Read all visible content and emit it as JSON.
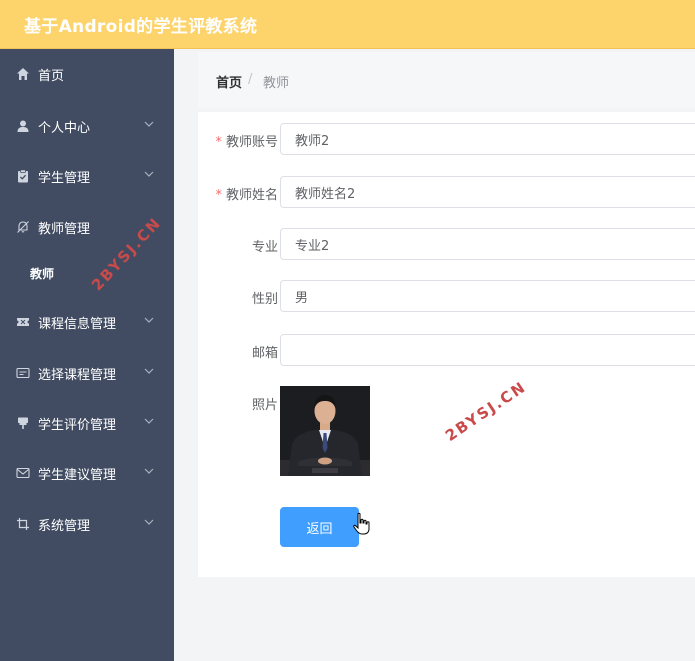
{
  "app": {
    "title": "基于Android的学生评教系统"
  },
  "sidebar": {
    "items": [
      {
        "label": "首页",
        "icon": "home-icon"
      },
      {
        "label": "个人中心",
        "icon": "user-icon"
      },
      {
        "label": "学生管理",
        "icon": "clipboard-icon"
      },
      {
        "label": "教师管理",
        "icon": "bell-off-icon"
      },
      {
        "label": "课程信息管理",
        "icon": "ticket-icon"
      },
      {
        "label": "选择课程管理",
        "icon": "message-box-icon"
      },
      {
        "label": "学生评价管理",
        "icon": "pin-icon"
      },
      {
        "label": "学生建议管理",
        "icon": "mail-icon"
      },
      {
        "label": "系统管理",
        "icon": "crop-icon"
      }
    ],
    "active_sub": "教师"
  },
  "breadcrumb": {
    "home": "首页",
    "separator": "/",
    "current": "教师"
  },
  "form": {
    "account": {
      "label": "教师账号",
      "value": "教师2"
    },
    "name": {
      "label": "教师姓名",
      "value": "教师姓名2"
    },
    "major": {
      "label": "专业",
      "value": "专业2"
    },
    "gender": {
      "label": "性别",
      "value": "男"
    },
    "email": {
      "label": "邮箱",
      "value": ""
    },
    "photo": {
      "label": "照片"
    },
    "required_mark": "*"
  },
  "actions": {
    "back_label": "返回"
  },
  "watermark": {
    "text": "2BYSJ.CN"
  },
  "colors": {
    "header": "#fdd36b",
    "sidebar": "#414c62",
    "primary": "#409eff",
    "required": "#f56c6c"
  }
}
